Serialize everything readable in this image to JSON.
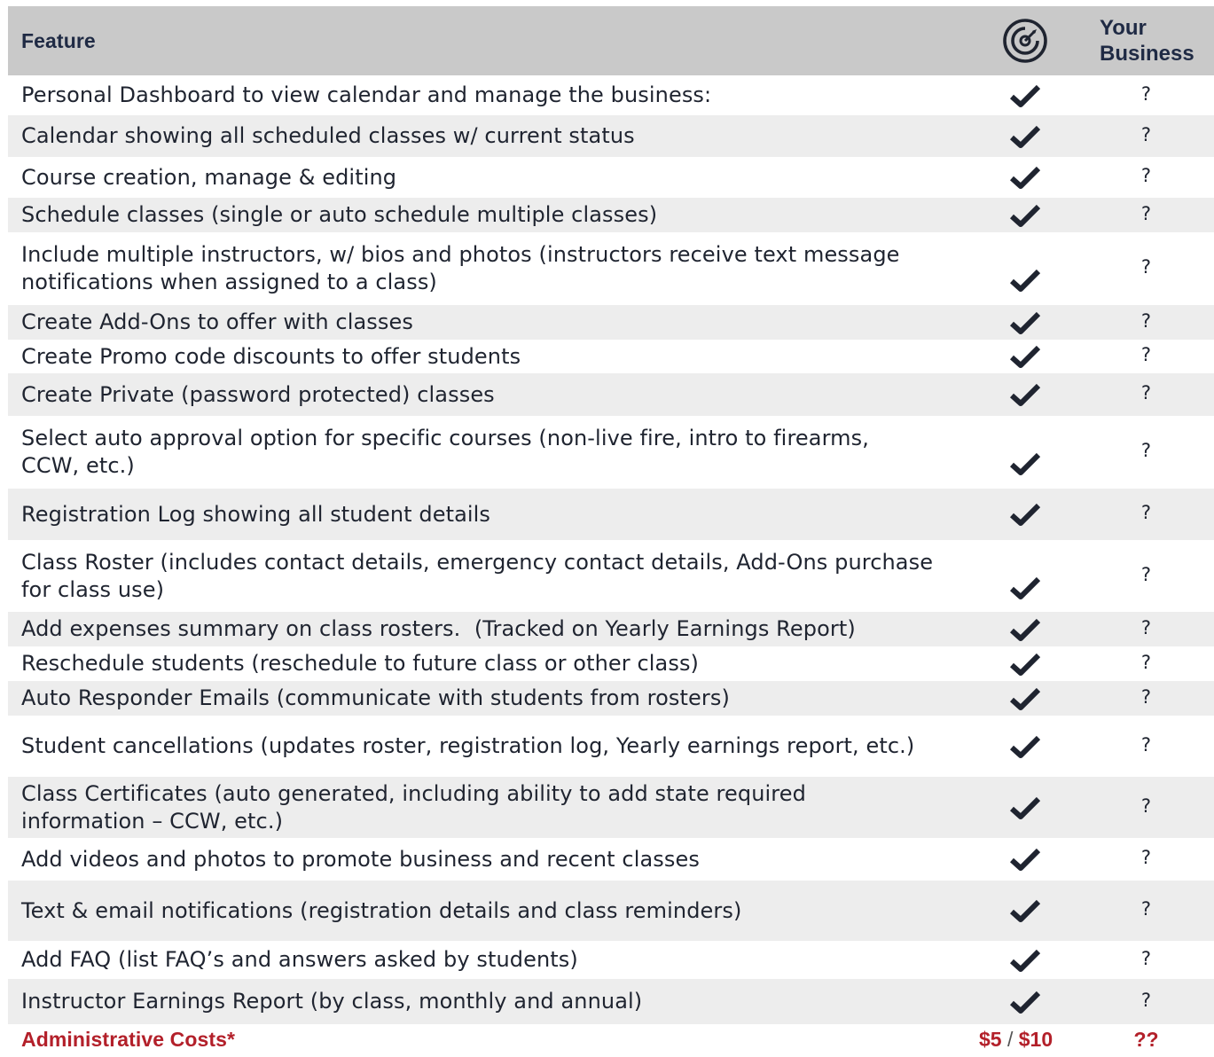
{
  "header": {
    "feature_label": "Feature",
    "brand_icon": "target-logo-icon",
    "your_label": "Your",
    "business_label": "Business"
  },
  "check_icon": "checkmark-icon",
  "rows": [
    {
      "feature": "Personal Dashboard to view calendar and manage the business:",
      "yours": "?"
    },
    {
      "feature": "Calendar showing all scheduled classes w/ current status",
      "yours": "?"
    },
    {
      "feature": "Course creation, manage & editing",
      "yours": "?"
    },
    {
      "feature": "Schedule classes (single or auto schedule multiple classes)",
      "yours": "?"
    },
    {
      "feature": "Include multiple instructors, w/ bios and photos (instructors receive text message notifications when assigned to a class)",
      "yours": "?"
    },
    {
      "feature": "Create Add-Ons to offer with classes",
      "yours": "?"
    },
    {
      "feature": "Create Promo code discounts to offer students",
      "yours": "?"
    },
    {
      "feature": "Create Private (password protected) classes",
      "yours": "?"
    },
    {
      "feature": "Select auto approval option for specific courses (non-live fire, intro to firearms, CCW, etc.)",
      "yours": "?"
    },
    {
      "feature": "Registration Log showing all student details",
      "yours": "?"
    },
    {
      "feature": "Class Roster (includes contact details, emergency contact details, Add-Ons purchase for class use)",
      "yours": "?"
    },
    {
      "feature": "Add expenses summary on class rosters.  (Tracked on Yearly Earnings Report)",
      "yours": "?"
    },
    {
      "feature": "Reschedule students (reschedule to future class or other class)",
      "yours": "?"
    },
    {
      "feature": "Auto Responder Emails (communicate with students from rosters)",
      "yours": "?"
    },
    {
      "feature": "Student cancellations (updates roster, registration log, Yearly earnings report, etc.)",
      "yours": "?"
    },
    {
      "feature": "Class Certificates (auto generated, including ability to add state required information – CCW, etc.)",
      "yours": "?"
    },
    {
      "feature": "Add videos and photos to promote business and recent classes",
      "yours": "?"
    },
    {
      "feature": "Text & email notifications (registration details and class reminders)",
      "yours": "?"
    },
    {
      "feature": "Add FAQ (list FAQ’s and answers asked by students)",
      "yours": "?"
    },
    {
      "feature": "Instructor Earnings Report (by class, monthly and annual)",
      "yours": "?"
    }
  ],
  "footer": {
    "label": "Administrative Costs*",
    "price_low": "$5",
    "separator": "/",
    "price_high": "$10",
    "yours": "??"
  },
  "colors": {
    "header_bg": "#c9c9c9",
    "stripe_bg": "#ededed",
    "accent_red": "#b3202a",
    "text_dark": "#1f2430"
  }
}
